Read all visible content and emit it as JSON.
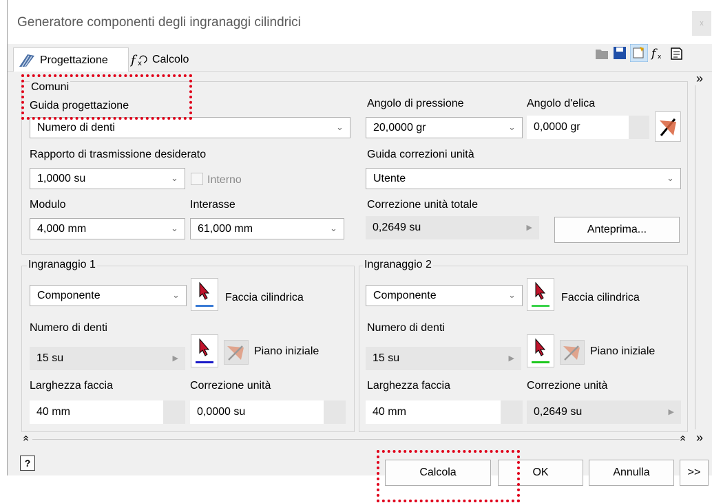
{
  "window": {
    "title": "Generatore componenti degli ingranaggi cilindrici",
    "close": "x"
  },
  "tabs": [
    {
      "label": "Progettazione"
    },
    {
      "label": "Calcolo"
    }
  ],
  "common": {
    "group_label": "Comuni",
    "design_guide_label": "Guida progettazione",
    "design_guide_value": "Numero di denti",
    "ratio_label": "Rapporto di trasmissione desiderato",
    "ratio_value": "1,0000 su",
    "internal_label": "Interno",
    "module_label": "Modulo",
    "module_value": "4,000 mm",
    "center_label": "Interasse",
    "center_value": "61,000 mm",
    "pressure_label": "Angolo di pressione",
    "pressure_value": "20,0000 gr",
    "helix_label": "Angolo d'elica",
    "helix_value": "0,0000 gr",
    "unitcorr_guide_label": "Guida correzioni unità",
    "unitcorr_guide_value": "Utente",
    "total_corr_label": "Correzione unità totale",
    "total_corr_value": "0,2649 su",
    "preview_button": "Anteprima..."
  },
  "gear1": {
    "group_label": "Ingranaggio 1",
    "type_value": "Componente",
    "cyl_face_label": "Faccia cilindrica",
    "teeth_label": "Numero di denti",
    "teeth_value": "15 su",
    "start_plane_label": "Piano iniziale",
    "width_label": "Larghezza faccia",
    "width_value": "40 mm",
    "corr_label": "Correzione unità",
    "corr_value": "0,0000 su",
    "accent": "#3a7bd5"
  },
  "gear2": {
    "group_label": "Ingranaggio 2",
    "type_value": "Componente",
    "cyl_face_label": "Faccia cilindrica",
    "teeth_label": "Numero di denti",
    "teeth_value": "15 su",
    "start_plane_label": "Piano iniziale",
    "width_label": "Larghezza faccia",
    "width_value": "40 mm",
    "corr_label": "Correzione unità",
    "corr_value": "0,2649 su",
    "accent": "#3ad34a"
  },
  "footer": {
    "help": "?",
    "calc_button": "Calcola",
    "ok_button": "OK",
    "cancel_button": "Annulla",
    "more_button": ">>"
  },
  "side": {
    "expand_top": "»",
    "expand_bottom": "»",
    "collapse": "«"
  }
}
